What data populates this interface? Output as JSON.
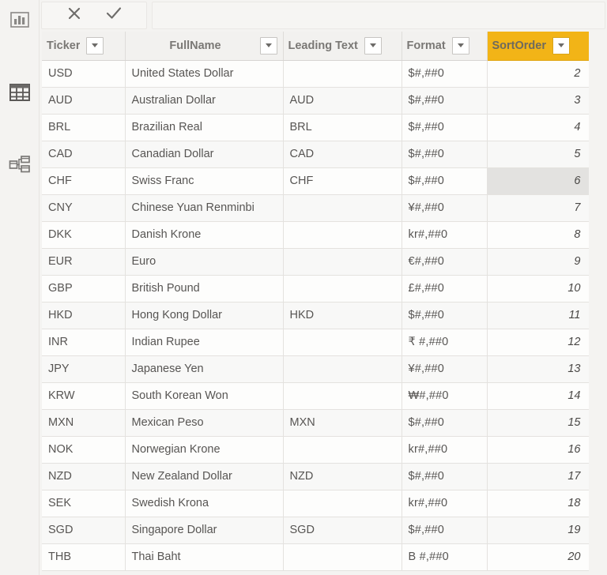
{
  "nav_rail": {
    "items": [
      {
        "name": "report-view",
        "icon": "bar-chart-icon",
        "label": "Report"
      },
      {
        "name": "data-view",
        "icon": "table-grid-icon",
        "label": "Data"
      },
      {
        "name": "model-view",
        "icon": "model-relationships-icon",
        "label": "Model"
      }
    ]
  },
  "formula_bar": {
    "cancel_label": "✕",
    "accept_label": "✓",
    "value": "",
    "placeholder": ""
  },
  "grid": {
    "columns": [
      {
        "key": "ticker",
        "label": "Ticker",
        "align": "left",
        "selected": false
      },
      {
        "key": "full",
        "label": "FullName",
        "align": "center",
        "selected": false
      },
      {
        "key": "lead",
        "label": "Leading Text",
        "align": "left",
        "selected": false
      },
      {
        "key": "format",
        "label": "Format",
        "align": "left",
        "selected": false
      },
      {
        "key": "sort",
        "label": "SortOrder",
        "align": "left",
        "selected": true
      }
    ],
    "selected_cell": {
      "row": 4,
      "column": "sort"
    },
    "rows": [
      {
        "ticker": "USD",
        "full": "United States Dollar",
        "lead": "",
        "format": "$#,##0",
        "sort": "2"
      },
      {
        "ticker": "AUD",
        "full": "Australian Dollar",
        "lead": "AUD",
        "format": "$#,##0",
        "sort": "3"
      },
      {
        "ticker": "BRL",
        "full": "Brazilian Real",
        "lead": "BRL",
        "format": "$#,##0",
        "sort": "4"
      },
      {
        "ticker": "CAD",
        "full": "Canadian Dollar",
        "lead": "CAD",
        "format": "$#,##0",
        "sort": "5"
      },
      {
        "ticker": "CHF",
        "full": "Swiss Franc",
        "lead": "CHF",
        "format": "$#,##0",
        "sort": "6"
      },
      {
        "ticker": "CNY",
        "full": "Chinese Yuan Renminbi",
        "lead": "",
        "format": "¥#,##0",
        "sort": "7"
      },
      {
        "ticker": "DKK",
        "full": "Danish Krone",
        "lead": "",
        "format": "kr#,##0",
        "sort": "8"
      },
      {
        "ticker": "EUR",
        "full": "Euro",
        "lead": "",
        "format": "€#,##0",
        "sort": "9"
      },
      {
        "ticker": "GBP",
        "full": "British Pound",
        "lead": "",
        "format": "£#,##0",
        "sort": "10"
      },
      {
        "ticker": "HKD",
        "full": "Hong Kong Dollar",
        "lead": "HKD",
        "format": "$#,##0",
        "sort": "11"
      },
      {
        "ticker": "INR",
        "full": "Indian Rupee",
        "lead": "",
        "format": "₹ #,##0",
        "sort": "12"
      },
      {
        "ticker": "JPY",
        "full": "Japanese Yen",
        "lead": "",
        "format": "¥#,##0",
        "sort": "13"
      },
      {
        "ticker": "KRW",
        "full": "South Korean Won",
        "lead": "",
        "format": "₩#,##0",
        "sort": "14"
      },
      {
        "ticker": "MXN",
        "full": "Mexican Peso",
        "lead": "MXN",
        "format": "$#,##0",
        "sort": "15"
      },
      {
        "ticker": "NOK",
        "full": "Norwegian Krone",
        "lead": "",
        "format": "kr#,##0",
        "sort": "16"
      },
      {
        "ticker": "NZD",
        "full": "New Zealand Dollar",
        "lead": "NZD",
        "format": "$#,##0",
        "sort": "17"
      },
      {
        "ticker": "SEK",
        "full": "Swedish Krona",
        "lead": "",
        "format": "kr#,##0",
        "sort": "18"
      },
      {
        "ticker": "SGD",
        "full": "Singapore Dollar",
        "lead": "SGD",
        "format": "$#,##0",
        "sort": "19"
      },
      {
        "ticker": "THB",
        "full": "Thai Baht",
        "lead": "",
        "format": "B #,##0",
        "sort": "20"
      }
    ]
  },
  "colors": {
    "selected_header_bg": "#f2b417",
    "selected_cell_bg": "#e3e2e0",
    "app_bg": "#f4f3f1",
    "grid_line": "#e4e2df"
  }
}
